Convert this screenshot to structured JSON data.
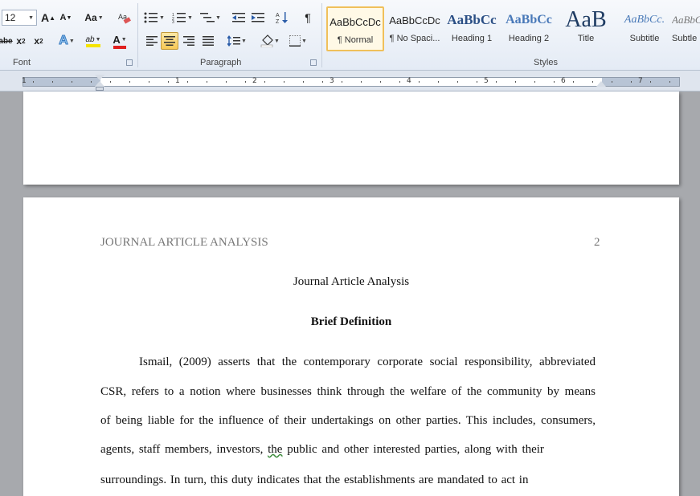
{
  "ribbon": {
    "font_size": "12",
    "font_group_label": "Font",
    "paragraph_group_label": "Paragraph",
    "styles_group_label": "Styles",
    "font_buttons": {
      "grow": "A",
      "shrink": "A",
      "change_case": "Aa",
      "strike": "abe",
      "subscript": "x",
      "superscript": "x",
      "text_effects": "A",
      "highlight": "ab",
      "font_color": "A"
    },
    "paragraph_buttons": {
      "pilcrow": "¶"
    },
    "styles": [
      {
        "sample": "AaBbCcDc",
        "name": "¶ Normal",
        "selected": true
      },
      {
        "sample": "AaBbCcDc",
        "name": "¶ No Spaci...",
        "selected": false
      },
      {
        "sample": "AaBbCc",
        "name": "Heading 1",
        "selected": false
      },
      {
        "sample": "AaBbCc",
        "name": "Heading 2",
        "selected": false
      },
      {
        "sample": "AaB",
        "name": "Title",
        "selected": false
      },
      {
        "sample": "AaBbCc.",
        "name": "Subtitle",
        "selected": false
      },
      {
        "sample": "AaBbCc",
        "name": "Subtle",
        "selected": false
      }
    ],
    "colors": {
      "highlight_bar": "#f5e400",
      "font_color_bar": "#e02020",
      "selected_border": "#f0c05a"
    }
  },
  "ruler": {
    "numbers": [
      "1",
      "1",
      "2",
      "3",
      "4",
      "5",
      "6",
      "7"
    ]
  },
  "document": {
    "page2": {
      "running_head": "JOURNAL ARTICLE ANALYSIS",
      "page_number": "2",
      "title": "Journal Article Analysis",
      "heading": "Brief Definition",
      "lines": [
        "Ismail, (2009) asserts that the contemporary corporate social responsibility, abbreviated",
        "CSR, refers to a notion where businesses think through the welfare of the community by means",
        "of being liable for the influence of their undertakings on other parties. This includes, consumers,",
        "agents, staff members, investors,",
        "surroundings. In turn, this duty indicates that the establishments are mandated to act in"
      ],
      "line4_word": "the",
      "line4_rest": "public and other interested parties, along with their"
    }
  }
}
